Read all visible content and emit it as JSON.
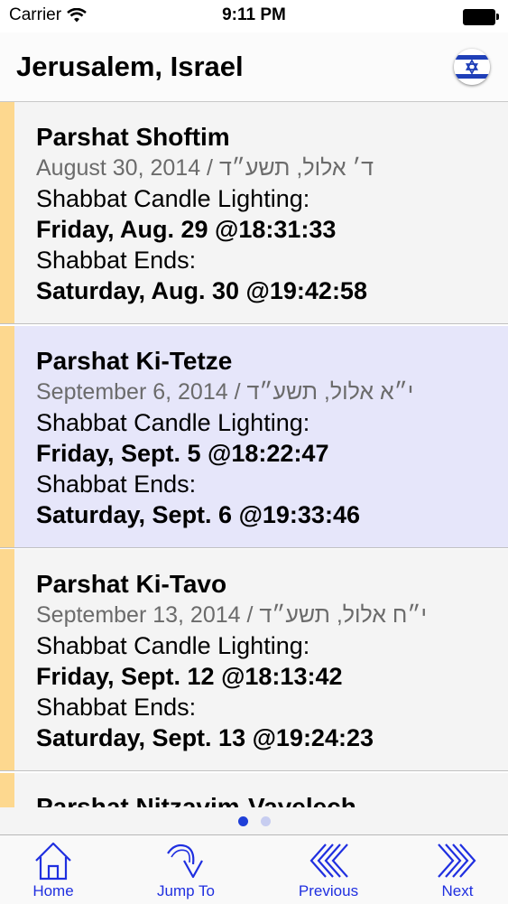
{
  "status_bar": {
    "carrier": "Carrier",
    "time": "9:11 PM"
  },
  "nav": {
    "title": "Jerusalem, Israel",
    "flag_icon": "israel-flag-icon"
  },
  "cards": [
    {
      "title": "Parshat Shoftim",
      "date": "August 30, 2014 / ד׳ אלול, תשע״ד",
      "candle_label": "Shabbat Candle Lighting:",
      "candle_time": "Friday, Aug. 29 @18:31:33",
      "ends_label": "Shabbat Ends:",
      "ends_time": "Saturday, Aug. 30 @19:42:58"
    },
    {
      "title": "Parshat Ki-Tetze",
      "date": "September 6, 2014 / י״א אלול, תשע״ד",
      "candle_label": "Shabbat Candle Lighting:",
      "candle_time": "Friday, Sept. 5 @18:22:47",
      "ends_label": "Shabbat Ends:",
      "ends_time": "Saturday, Sept. 6 @19:33:46"
    },
    {
      "title": "Parshat Ki-Tavo",
      "date": "September 13, 2014 / י״ח אלול, תשע״ד",
      "candle_label": "Shabbat Candle Lighting:",
      "candle_time": "Friday, Sept. 12 @18:13:42",
      "ends_label": "Shabbat Ends:",
      "ends_time": "Saturday, Sept. 13 @19:24:23"
    }
  ],
  "partial_card": {
    "title": "Parshat Nitzavim-Vayelech"
  },
  "pager": {
    "pages": 2,
    "current": 1
  },
  "tabs": [
    {
      "label": "Home",
      "icon": "home-icon"
    },
    {
      "label": "Jump To",
      "icon": "jump-arrow-icon"
    },
    {
      "label": "Previous",
      "icon": "double-chevron-left-icon"
    },
    {
      "label": "Next",
      "icon": "double-chevron-right-icon"
    }
  ],
  "colors": {
    "accent_bar": "#fdd88f",
    "highlight_row": "#e6e6fa",
    "tab_tint": "#1f2fe0",
    "page_dot_active": "#1f3fd8"
  }
}
